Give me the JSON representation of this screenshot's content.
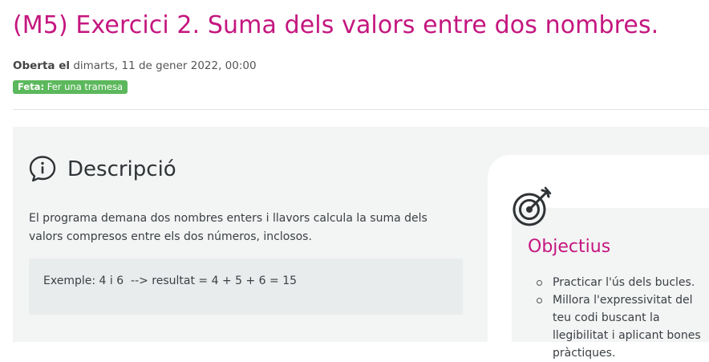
{
  "activity": {
    "title": "(M5) Exercici 2. Suma dels valors entre dos nombres.",
    "dates": {
      "label": "Oberta el",
      "value": "dimarts, 11 de gener 2022, 00:00"
    },
    "completion": {
      "label": "Feta:",
      "value": "Fer una tramesa",
      "color": "#5cb85c"
    }
  },
  "description": {
    "icon": "info-icon",
    "heading": "Descripció",
    "text": "El programa demana dos nombres enters i llavors calcula la suma dels valors compresos entre els dos números, inclosos.",
    "example": "Exemple: 4 i 6  --> resultat = 4 + 5 + 6 = 15"
  },
  "objectives": {
    "icon": "target-icon",
    "heading": "Objectius",
    "items": [
      "Practicar l'ús dels bucles.",
      "Millora l'expressivitat del teu codi buscant la llegibilitat i aplicant bones pràctiques."
    ]
  },
  "colors": {
    "accent": "#c4167f",
    "panel": "#f3f4f4",
    "example_bg": "#e9eced"
  }
}
